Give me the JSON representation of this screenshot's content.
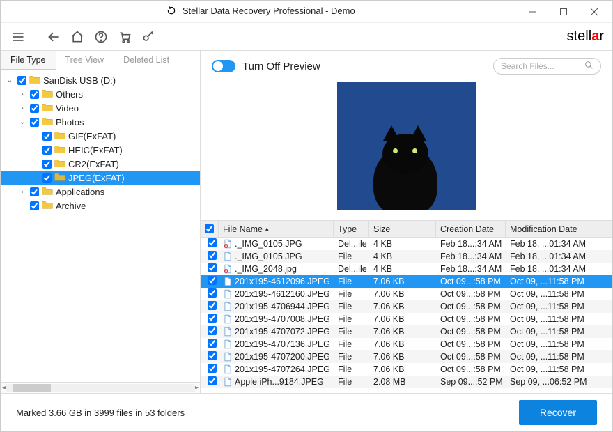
{
  "window": {
    "title": "Stellar Data Recovery Professional - Demo"
  },
  "brand": "stellar",
  "tabs": [
    "File Type",
    "Tree View",
    "Deleted List"
  ],
  "activeTab": 0,
  "tree": [
    {
      "indent": 0,
      "expander": "v",
      "checked": true,
      "label": "SanDisk USB (D:)",
      "open": false,
      "selected": false
    },
    {
      "indent": 1,
      "expander": ">",
      "checked": true,
      "label": "Others",
      "open": false,
      "selected": false
    },
    {
      "indent": 1,
      "expander": ">",
      "checked": true,
      "label": "Video",
      "open": false,
      "selected": false
    },
    {
      "indent": 1,
      "expander": "v",
      "checked": true,
      "label": "Photos",
      "open": false,
      "selected": false
    },
    {
      "indent": 2,
      "expander": "",
      "checked": true,
      "label": "GIF(ExFAT)",
      "open": false,
      "selected": false
    },
    {
      "indent": 2,
      "expander": "",
      "checked": true,
      "label": "HEIC(ExFAT)",
      "open": false,
      "selected": false
    },
    {
      "indent": 2,
      "expander": "",
      "checked": true,
      "label": "CR2(ExFAT)",
      "open": false,
      "selected": false
    },
    {
      "indent": 2,
      "expander": "",
      "checked": true,
      "label": "JPEG(ExFAT)",
      "open": true,
      "selected": true
    },
    {
      "indent": 1,
      "expander": ">",
      "checked": true,
      "label": "Applications",
      "open": false,
      "selected": false
    },
    {
      "indent": 1,
      "expander": "",
      "checked": true,
      "label": "Archive",
      "open": false,
      "selected": false
    }
  ],
  "preview_label": "Turn Off Preview",
  "search_placeholder": "Search Files...",
  "table": {
    "headers": {
      "name": "File Name",
      "type": "Type",
      "size": "Size",
      "cdate": "Creation Date",
      "mdate": "Modification Date"
    },
    "rows": [
      {
        "chk": true,
        "deleted": true,
        "name": "._IMG_0105.JPG",
        "type": "Del...ile",
        "size": "4 KB",
        "cdate": "Feb 18...:34 AM",
        "mdate": "Feb 18, ...01:34 AM",
        "selected": false
      },
      {
        "chk": true,
        "deleted": false,
        "name": "._IMG_0105.JPG",
        "type": "File",
        "size": "4 KB",
        "cdate": "Feb 18...:34 AM",
        "mdate": "Feb 18, ...01:34 AM",
        "selected": false
      },
      {
        "chk": true,
        "deleted": true,
        "name": "._IMG_2048.jpg",
        "type": "Del...ile",
        "size": "4 KB",
        "cdate": "Feb 18...:34 AM",
        "mdate": "Feb 18, ...01:34 AM",
        "selected": false
      },
      {
        "chk": true,
        "deleted": false,
        "name": "201x195-4612096.JPEG",
        "type": "File",
        "size": "7.06 KB",
        "cdate": "Oct 09...:58 PM",
        "mdate": "Oct 09, ...11:58 PM",
        "selected": true
      },
      {
        "chk": true,
        "deleted": false,
        "name": "201x195-4612160.JPEG",
        "type": "File",
        "size": "7.06 KB",
        "cdate": "Oct 09...:58 PM",
        "mdate": "Oct 09, ...11:58 PM",
        "selected": false
      },
      {
        "chk": true,
        "deleted": false,
        "name": "201x195-4706944.JPEG",
        "type": "File",
        "size": "7.06 KB",
        "cdate": "Oct 09...:58 PM",
        "mdate": "Oct 09, ...11:58 PM",
        "selected": false
      },
      {
        "chk": true,
        "deleted": false,
        "name": "201x195-4707008.JPEG",
        "type": "File",
        "size": "7.06 KB",
        "cdate": "Oct 09...:58 PM",
        "mdate": "Oct 09, ...11:58 PM",
        "selected": false
      },
      {
        "chk": true,
        "deleted": false,
        "name": "201x195-4707072.JPEG",
        "type": "File",
        "size": "7.06 KB",
        "cdate": "Oct 09...:58 PM",
        "mdate": "Oct 09, ...11:58 PM",
        "selected": false
      },
      {
        "chk": true,
        "deleted": false,
        "name": "201x195-4707136.JPEG",
        "type": "File",
        "size": "7.06 KB",
        "cdate": "Oct 09...:58 PM",
        "mdate": "Oct 09, ...11:58 PM",
        "selected": false
      },
      {
        "chk": true,
        "deleted": false,
        "name": "201x195-4707200.JPEG",
        "type": "File",
        "size": "7.06 KB",
        "cdate": "Oct 09...:58 PM",
        "mdate": "Oct 09, ...11:58 PM",
        "selected": false
      },
      {
        "chk": true,
        "deleted": false,
        "name": "201x195-4707264.JPEG",
        "type": "File",
        "size": "7.06 KB",
        "cdate": "Oct 09...:58 PM",
        "mdate": "Oct 09, ...11:58 PM",
        "selected": false
      },
      {
        "chk": true,
        "deleted": false,
        "name": "Apple iPh...9184.JPEG",
        "type": "File",
        "size": "2.08 MB",
        "cdate": "Sep 09...:52 PM",
        "mdate": "Sep 09, ...06:52 PM",
        "selected": false
      }
    ]
  },
  "footer_text": "Marked 3.66 GB in 3999 files in 53 folders",
  "recover_label": "Recover"
}
